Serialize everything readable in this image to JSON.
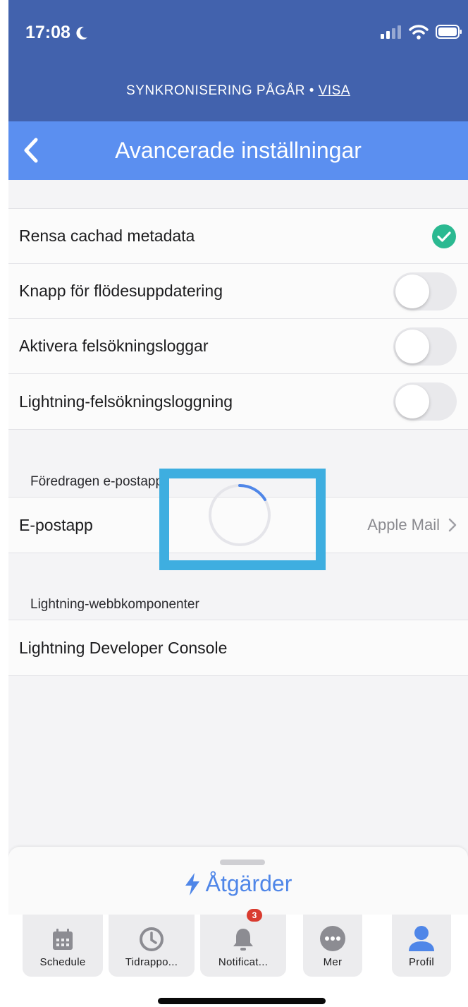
{
  "status": {
    "time": "17:08"
  },
  "sync_banner": {
    "text": "SYNKRONISERING PÅGÅR •",
    "link": "VISA"
  },
  "nav": {
    "title": "Avancerade inställningar"
  },
  "settings": [
    {
      "label": "Rensa cachad metadata",
      "state": "done"
    },
    {
      "label": "Knapp för flödesuppdatering",
      "toggle": false
    },
    {
      "label": "Aktivera felsökningsloggar",
      "toggle": false
    },
    {
      "label": "Lightning-felsökningsloggning",
      "toggle": false
    }
  ],
  "email_section": {
    "header": "Föredragen e-postapp",
    "row_label": "E-postapp",
    "row_value": "Apple Mail"
  },
  "lightning_section": {
    "header": "Lightning-webbkomponenter",
    "row_label": "Lightning Developer Console"
  },
  "actions_sheet": {
    "label": "Åtgärder"
  },
  "tabs": [
    {
      "label": "Schedule",
      "icon": "calendar-icon"
    },
    {
      "label": "Tidrappo...",
      "icon": "clock-icon"
    },
    {
      "label": "Notificat...",
      "icon": "bell-icon",
      "badge": "3"
    },
    {
      "label": "Mer",
      "icon": "more-icon"
    },
    {
      "label": "Profil",
      "icon": "person-icon"
    }
  ],
  "colors": {
    "status_bar": "#4262ad",
    "nav_bar": "#5b8ff0",
    "accent": "#4f86e8",
    "check": "#2bb991",
    "spinner_highlight": "#3eaee0",
    "badge": "#d93b2f"
  }
}
